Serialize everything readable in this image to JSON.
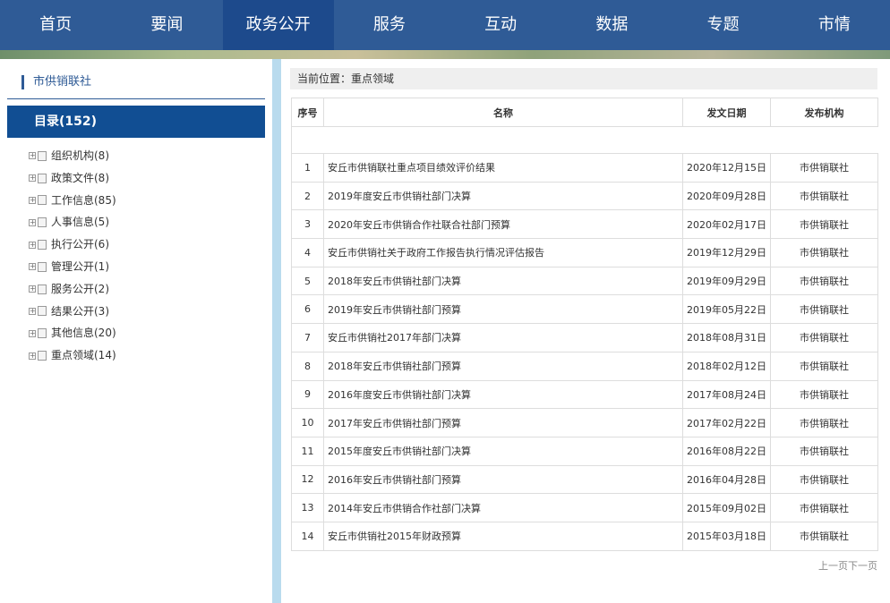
{
  "nav": {
    "items": [
      "首页",
      "要闻",
      "政务公开",
      "服务",
      "互动",
      "数据",
      "专题",
      "市情"
    ],
    "active_index": 2
  },
  "left": {
    "title": "市供销联社",
    "directory": "目录(152)",
    "tree": [
      "组织机构(8)",
      "政策文件(8)",
      "工作信息(85)",
      "人事信息(5)",
      "执行公开(6)",
      "管理公开(1)",
      "服务公开(2)",
      "结果公开(3)",
      "其他信息(20)",
      "重点领域(14)"
    ]
  },
  "breadcrumb": {
    "label": "当前位置：",
    "location": "重点领域"
  },
  "table": {
    "headers": {
      "no": "序号",
      "name": "名称",
      "date": "发文日期",
      "org": "发布机构"
    },
    "rows": [
      {
        "no": "1",
        "name": "安丘市供销联社重点项目绩效评价结果",
        "date": "2020年12月15日",
        "org": "市供销联社"
      },
      {
        "no": "2",
        "name": "2019年度安丘市供销社部门决算",
        "date": "2020年09月28日",
        "org": "市供销联社"
      },
      {
        "no": "3",
        "name": "2020年安丘市供销合作社联合社部门预算",
        "date": "2020年02月17日",
        "org": "市供销联社"
      },
      {
        "no": "4",
        "name": "安丘市供销社关于政府工作报告执行情况评估报告",
        "date": "2019年12月29日",
        "org": "市供销联社"
      },
      {
        "no": "5",
        "name": "2018年安丘市供销社部门决算",
        "date": "2019年09月29日",
        "org": "市供销联社"
      },
      {
        "no": "6",
        "name": "2019年安丘市供销社部门预算",
        "date": "2019年05月22日",
        "org": "市供销联社"
      },
      {
        "no": "7",
        "name": "安丘市供销社2017年部门决算",
        "date": "2018年08月31日",
        "org": "市供销联社"
      },
      {
        "no": "8",
        "name": "2018年安丘市供销社部门预算",
        "date": "2018年02月12日",
        "org": "市供销联社"
      },
      {
        "no": "9",
        "name": "2016年度安丘市供销社部门决算",
        "date": "2017年08月24日",
        "org": "市供销联社"
      },
      {
        "no": "10",
        "name": "2017年安丘市供销社部门预算",
        "date": "2017年02月22日",
        "org": "市供销联社"
      },
      {
        "no": "11",
        "name": "2015年度安丘市供销社部门决算",
        "date": "2016年08月22日",
        "org": "市供销联社"
      },
      {
        "no": "12",
        "name": "2016年安丘市供销社部门预算",
        "date": "2016年04月28日",
        "org": "市供销联社"
      },
      {
        "no": "13",
        "name": "2014年安丘市供销合作社部门决算",
        "date": "2015年09月02日",
        "org": "市供销联社"
      },
      {
        "no": "14",
        "name": "安丘市供销社2015年财政预算",
        "date": "2015年03月18日",
        "org": "市供销联社"
      }
    ]
  },
  "pager": {
    "prev": "上一页",
    "next": "下一页"
  },
  "colors": {
    "nav_bg": "#2f5b96",
    "nav_active": "#1d4a8c",
    "directory_bg": "#114e93",
    "separator": "#b9dbee"
  }
}
